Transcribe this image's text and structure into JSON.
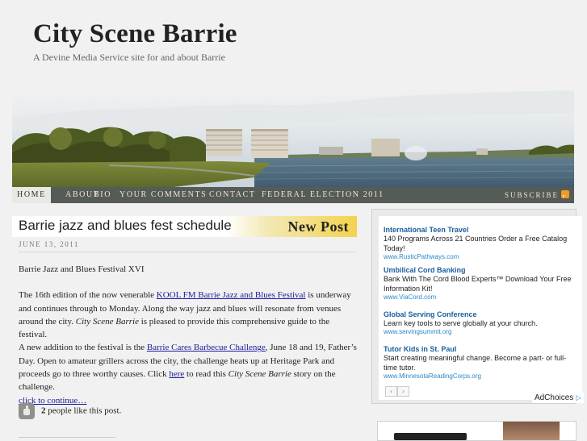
{
  "site": {
    "title": "City Scene Barrie",
    "tagline": "A Devine Media Service site for and about Barrie"
  },
  "nav": {
    "items": [
      {
        "label": "Home",
        "active": true
      },
      {
        "label": "About",
        "active": false
      },
      {
        "label": "Bio",
        "active": false
      },
      {
        "label": "Your Comments",
        "active": false
      },
      {
        "label": "Contact",
        "active": false
      },
      {
        "label": "Federal Election 2011",
        "active": false
      }
    ],
    "subscribe_label": "SUBSCRIBE"
  },
  "post": {
    "title": "Barrie jazz and blues fest schedule",
    "badge": "New Post",
    "date": "JUNE 13, 2011",
    "intro": "Barrie Jazz and Blues Festival XVI",
    "p1_a": "The 16th edition of the now venerable ",
    "p1_link": "KOOL FM Barrie Jazz and Blues Festival",
    "p1_b": " is underway and continues through to Monday. Along the way jazz and blues will resonate from venues around the city. ",
    "p1_italic": "City Scene Barrie",
    "p1_c": " is pleased to provide this comprehensive guide to the festival.",
    "p2_a": "A new addition to the festival is the ",
    "p2_link": "Barrie Cares Barbecue Challenge",
    "p2_b": ", June 18 and 19, Father’s Day. Open to amateur grillers across the city, the challenge heats up at Heritage Park and proceeds go to three worthy causes. Click ",
    "p2_here": "here",
    "p2_c": " to read this ",
    "p2_italic": "City Scene Barrie",
    "p2_d": " story on the challenge.",
    "continue": "click to continue…",
    "likes_count": "2",
    "likes_text": " people like this post."
  },
  "ads": {
    "items": [
      {
        "title": "International Teen Travel",
        "text": "140 Programs Across 21 Countries Order a Free Catalog Today!",
        "url": "www.RusticPathways.com"
      },
      {
        "title": "Umbilical Cord Banking",
        "text": "Bank With The Cord Blood Experts™ Download Your Free Information Kit!",
        "url": "www.ViaCord.com"
      },
      {
        "title": "Global Serving Conference",
        "text": "Learn key tools to serve globally at your church.",
        "url": "www.servingsummit.org"
      },
      {
        "title": "Tutor Kids in St. Paul",
        "text": "Start creating meaningful change. Become a part- or full-time tutor.",
        "url": "www.MinnesotaReadingCorps.org"
      }
    ],
    "prev_label": "‹",
    "next_label": "›",
    "adchoices_label": "AdChoices",
    "adchoices_icon": "▷"
  },
  "colors": {
    "nav_bg": "#555b56",
    "ad_title": "#1a5ea0",
    "ad_url": "#2a88c9",
    "badge_bg": "#f4d34c"
  }
}
